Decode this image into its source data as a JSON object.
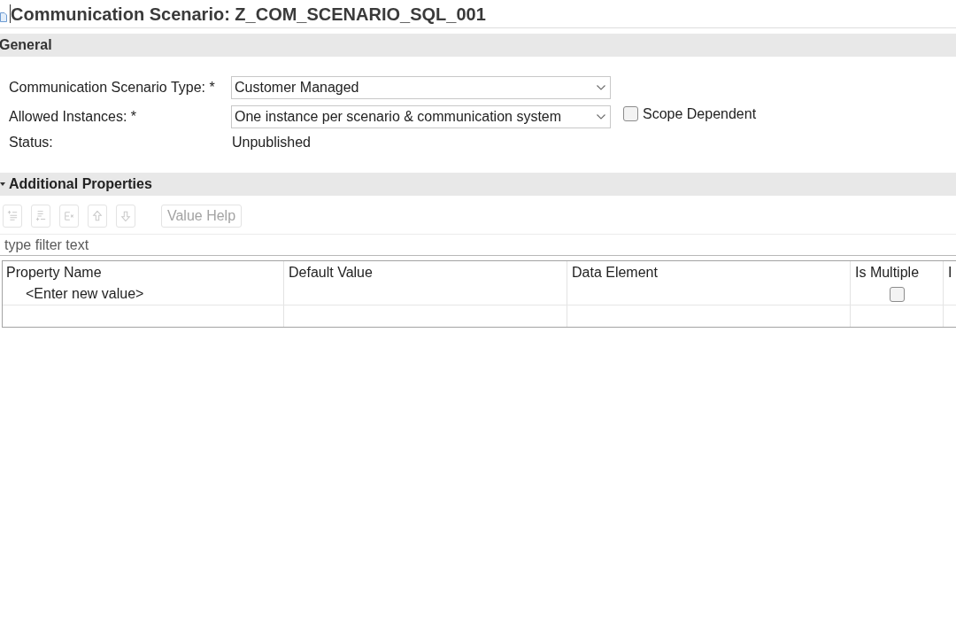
{
  "editor": {
    "title": "Communication Scenario: Z_COM_SCENARIO_SQL_001"
  },
  "general": {
    "title": "General",
    "fields": [
      {
        "kind": "dropdown",
        "label": "Communication Scenario Type: *",
        "value": "Customer Managed"
      },
      {
        "kind": "dropdown",
        "label": "Allowed Instances: *",
        "value": "One instance per scenario & communication system",
        "option": {
          "label": "Scope Dependent",
          "checked": false
        }
      },
      {
        "kind": "text",
        "label": "Status:",
        "value": "Unpublished"
      }
    ]
  },
  "additional_properties": {
    "title": "Additional Properties",
    "expanded": true,
    "toolbar": {
      "icon_buttons": [
        {
          "disabled": true
        },
        {
          "disabled": true
        },
        {
          "disabled": true
        },
        {
          "disabled": true
        },
        {
          "disabled": true
        }
      ],
      "buttons": [
        {
          "label": "Value Help",
          "disabled": true
        }
      ]
    },
    "filter": {
      "placeholder": "type filter text"
    },
    "table": {
      "columns": [
        "Property Name",
        "Default Value",
        "Data Element",
        "Is Multiple",
        "I"
      ],
      "rows": [
        {
          "property_name": "<Enter new value>",
          "is_multiple": false
        }
      ]
    }
  }
}
